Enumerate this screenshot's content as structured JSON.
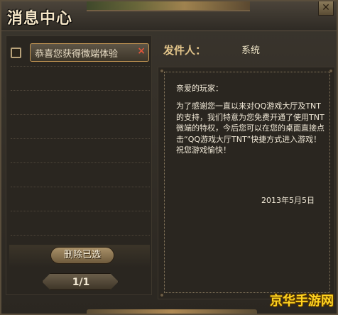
{
  "window": {
    "title": "消息中心",
    "close_glyph": "✕"
  },
  "message_list": {
    "items": [
      {
        "subject": "恭喜您获得微端体验",
        "delete_glyph": "×"
      }
    ],
    "delete_selected_label": "删除已选",
    "pager": "1/1"
  },
  "message": {
    "sender_label": "发件人：",
    "sender_value": "系统",
    "greeting": "亲爱的玩家：",
    "body": "为了感谢您一直以来对QQ游戏大厅及TNT的支持，我们特意为您免费开通了使用TNT微端的特权，今后您可以在您的桌面直接点击“QQ游戏大厅TNT”快捷方式进入游戏！祝您游戏愉快！",
    "date": "2013年5月5日"
  },
  "watermark": "京华手游网",
  "colors": {
    "accent_border": "#c89a55",
    "delete_x": "#e0553a",
    "sender_label": "#e2c48a",
    "watermark": "#ffd320"
  }
}
